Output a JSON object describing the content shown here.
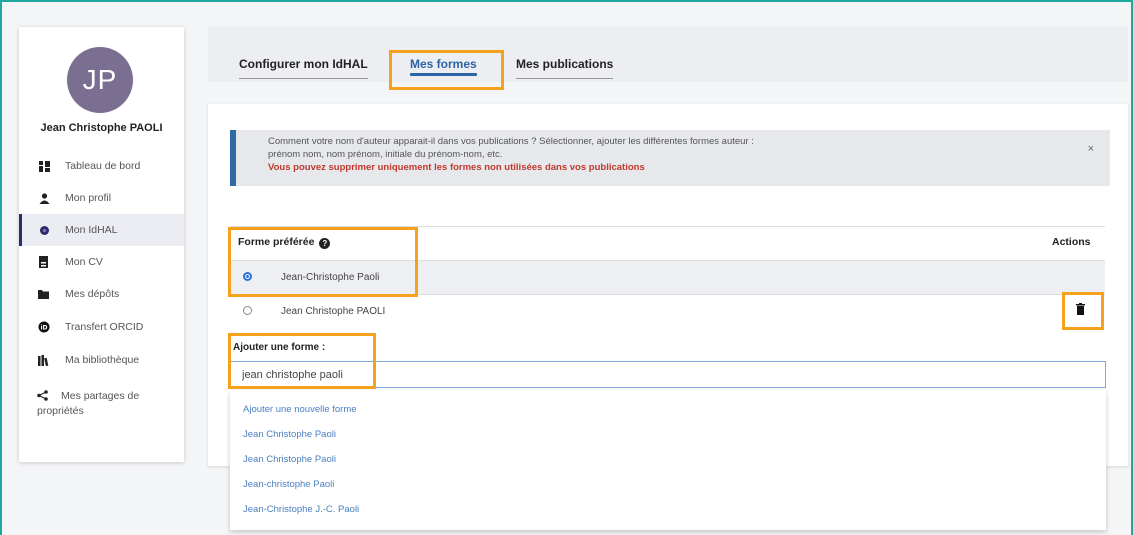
{
  "user": {
    "initials": "JP",
    "name": "Jean Christophe PAOLI"
  },
  "sidebar": {
    "items": [
      {
        "label": "Tableau de bord",
        "icon": "dashboard-icon"
      },
      {
        "label": "Mon profil",
        "icon": "user-icon"
      },
      {
        "label": "Mon IdHAL",
        "icon": "idhal-icon",
        "active": true
      },
      {
        "label": "Mon CV",
        "icon": "cv-icon"
      },
      {
        "label": "Mes dépôts",
        "icon": "folder-icon"
      },
      {
        "label": "Transfert ORCID",
        "icon": "orcid-icon"
      },
      {
        "label": "Ma bibliothèque",
        "icon": "library-icon"
      },
      {
        "label": "Mes partages de propriétés",
        "icon": "share-icon"
      }
    ]
  },
  "tabs": [
    {
      "label": "Configurer mon IdHAL"
    },
    {
      "label": "Mes formes",
      "active": true
    },
    {
      "label": "Mes publications"
    }
  ],
  "info": {
    "line1": "Comment votre nom d'auteur apparait-il dans vos publications ? Sélectionner, ajouter les différentes formes auteur :",
    "line2": "prénom nom, nom prénom, initiale du prénom-nom, etc.",
    "warning": "Vous pouvez supprimer uniquement les formes non utilisées dans vos publications",
    "close": "×"
  },
  "table": {
    "col_preferred": "Forme préférée",
    "col_actions": "Actions",
    "rows": [
      {
        "label": "Jean-Christophe Paoli",
        "selected": true
      },
      {
        "label": "Jean Christophe PAOLI",
        "selected": false
      }
    ]
  },
  "add_form": {
    "label": "Ajouter une forme :",
    "value": "jean christophe paoli",
    "suggestions": [
      "Ajouter une nouvelle forme",
      "Jean Christophe Paoli",
      "Jean Christophe Paoli",
      "Jean-christophe Paoli",
      "Jean-Christophe J.-C. Paoli"
    ]
  },
  "colors": {
    "accent": "#2b64a8",
    "highlight": "#f5a11b",
    "warning": "#c0392b",
    "avatar": "#7a6f91"
  }
}
